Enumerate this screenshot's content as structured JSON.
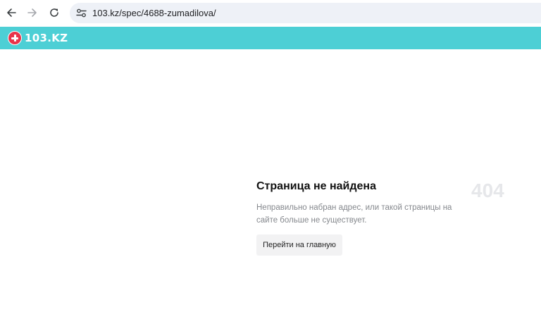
{
  "browser": {
    "url": "103.kz/spec/4688-zumadilova/",
    "icons": {
      "back": "arrow-left-icon",
      "forward": "arrow-right-icon",
      "reload": "reload-icon",
      "site_info": "tune-icon"
    }
  },
  "site": {
    "logo_text": "103.KZ",
    "header_color": "#4dcfd5",
    "logo_color": "#e8334a"
  },
  "error": {
    "title": "Страница не найдена",
    "code": "404",
    "description": "Неправильно набран адрес, или такой страницы на сайте больше не существует.",
    "home_button": "Перейти на главную"
  }
}
